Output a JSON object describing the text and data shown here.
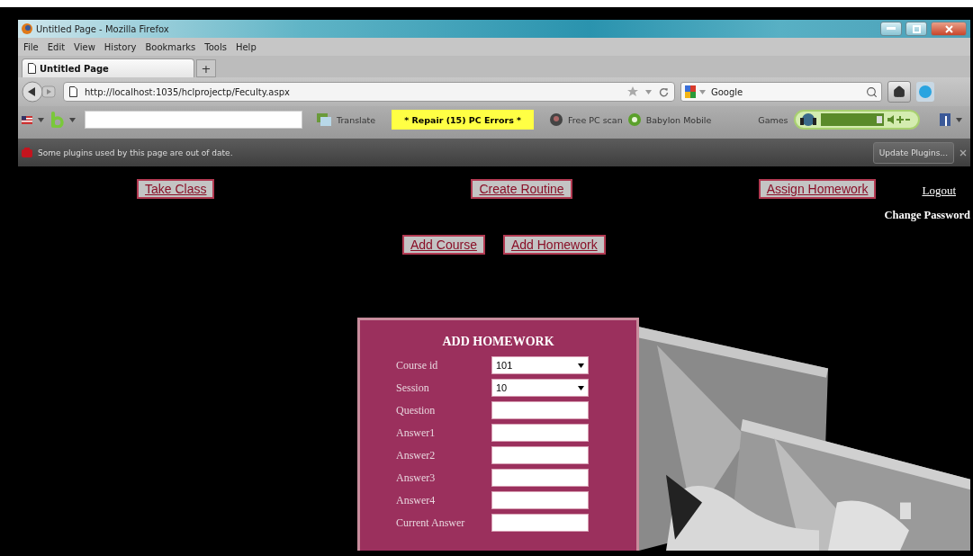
{
  "window": {
    "title": "Untitled Page - Mozilla Firefox"
  },
  "menu": [
    "File",
    "Edit",
    "View",
    "History",
    "Bookmarks",
    "Tools",
    "Help"
  ],
  "tabs": [
    {
      "label": "Untitled Page",
      "selected": true
    }
  ],
  "new_tab": "+",
  "address": {
    "value": "http://localhost:1035/hclprojectp/Feculty.aspx"
  },
  "search": {
    "placeholder": "Google"
  },
  "toolbar": {
    "translate": "Translate",
    "repair": "* Repair (15) PC Errors *",
    "free_scan": "Free PC scan",
    "mobile": "Babylon Mobile",
    "games": "Games"
  },
  "notification": {
    "text": "Some plugins used by this page are out of date.",
    "button": "Update Plugins..."
  },
  "nav": [
    "Take Class",
    "Create Routine",
    "Assign Homework"
  ],
  "logout": "Logout",
  "change_password": "Change Password",
  "sub_nav": [
    "Add Course",
    "Add Homework"
  ],
  "form": {
    "title": "ADD HOMEWORK",
    "fields": [
      {
        "label": "Course id",
        "kind": "select",
        "value": "101"
      },
      {
        "label": "Session",
        "kind": "select",
        "value": "10"
      },
      {
        "label": "Question",
        "kind": "text"
      },
      {
        "label": "Answer1",
        "kind": "text"
      },
      {
        "label": "Answer2",
        "kind": "text"
      },
      {
        "label": "Answer3",
        "kind": "text"
      },
      {
        "label": "Answer4",
        "kind": "text"
      },
      {
        "label": "Current Answer",
        "kind": "text"
      }
    ]
  }
}
